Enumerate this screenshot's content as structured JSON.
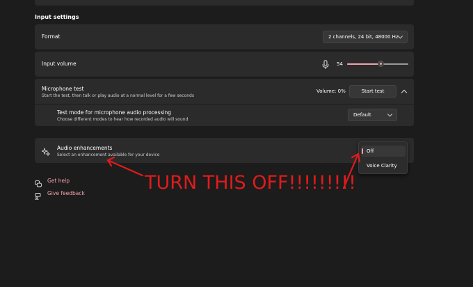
{
  "section": {
    "title": "Input settings"
  },
  "format": {
    "label": "Format",
    "value": "2 channels, 24 bit, 48000 Hz"
  },
  "input_volume": {
    "label": "Input volume",
    "value": "54",
    "level": 0.54
  },
  "mic_test": {
    "label": "Microphone test",
    "sub": "Start the test, then talk or play audio at a normal level for a few seconds",
    "volume_text": "Volume: 0%",
    "start_label": "Start test"
  },
  "test_mode": {
    "label": "Test mode for microphone audio processing",
    "sub": "Choose different modes to hear how recorded audio will sound",
    "value": "Default"
  },
  "audio_enh": {
    "label": "Audio enhancements",
    "sub": "Select an enhancement available for your device",
    "options": [
      "Off",
      "Voice Clarity"
    ],
    "selected": "Off"
  },
  "links": {
    "help": "Get help",
    "feedback": "Give feedback"
  },
  "annotation": {
    "text": "TURN THIS OFF!!!!!!!!!"
  },
  "colors": {
    "accent": "#f3a2ad",
    "annotation": "#e01b1b",
    "card": "#2b2b2b",
    "background": "#1c1c1c"
  }
}
